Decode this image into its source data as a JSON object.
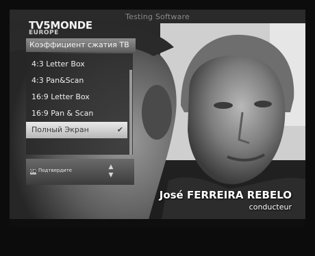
{
  "screen": {
    "title": "Testing Software",
    "logo_main": "TV5MONDE",
    "logo_sub": "EUROPE"
  },
  "menu": {
    "title": "Коэффициент сжатия ТВ",
    "items": [
      {
        "label": "4:3 Letter Box",
        "selected": false
      },
      {
        "label": "4:3 Pan&Scan",
        "selected": false
      },
      {
        "label": "16:9 Letter Box",
        "selected": false
      },
      {
        "label": "16:9 Pan & Scan",
        "selected": false
      },
      {
        "label": "Полный Экран",
        "selected": true,
        "checked": true
      }
    ],
    "footer": {
      "ok_key": "OK",
      "confirm_label": "Подтвердите"
    }
  },
  "caption": {
    "name": "José FERREIRA REBELO",
    "role": "conducteur"
  }
}
